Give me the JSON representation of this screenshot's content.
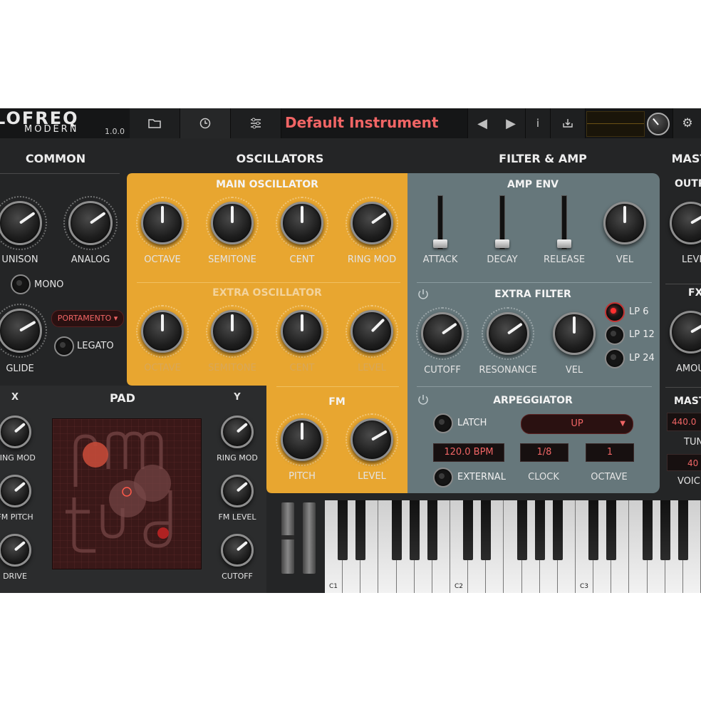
{
  "toolbar": {
    "logo_line1": "LOFREQ",
    "logo_line2": "MODERN",
    "version": "1.0.0",
    "preset_name": "Default Instrument",
    "info_label": "i"
  },
  "sections": {
    "common": "COMMON",
    "oscillators": "OSCILLATORS",
    "filter_amp": "FILTER & AMP",
    "master": "MAST"
  },
  "common": {
    "unison": "UNISON",
    "analog": "ANALOG",
    "mono": "MONO",
    "portamento": "PORTAMENTO ▾",
    "legato": "LEGATO",
    "glide": "GLIDE"
  },
  "main_osc": {
    "title": "MAIN OSCILLATOR",
    "knobs": [
      "OCTAVE",
      "SEMITONE",
      "CENT",
      "RING MOD"
    ]
  },
  "extra_osc": {
    "title": "EXTRA OSCILLATOR",
    "knobs": [
      "OCTAVE",
      "SEMITONE",
      "CENT",
      "LEVEL"
    ]
  },
  "fm": {
    "title": "FM",
    "pitch": "PITCH",
    "level": "LEVEL"
  },
  "amp_env": {
    "title": "AMP ENV",
    "attack": "ATTACK",
    "decay": "DECAY",
    "release": "RELEASE",
    "vel": "VEL"
  },
  "extra_filter": {
    "title": "EXTRA FILTER",
    "cutoff": "CUTOFF",
    "resonance": "RESONANCE",
    "vel": "VEL",
    "modes": [
      "LP 6",
      "LP 12",
      "LP 24"
    ],
    "selected_mode": "LP 6"
  },
  "arp": {
    "title": "ARPEGGIATOR",
    "latch": "LATCH",
    "direction": "UP",
    "bpm": "120.0 BPM",
    "clock_value": "1/8",
    "octave_value": "1",
    "external": "EXTERNAL",
    "clock": "CLOCK",
    "octave": "OCTAVE"
  },
  "master_partial": {
    "output": "OUTP",
    "level": "LEVE",
    "fx": "FX",
    "amount": "AMOU",
    "master": "MAST",
    "tune_value": "440.0",
    "tune": "TUN",
    "voices_value": "40",
    "voices": "VOICE"
  },
  "pad": {
    "title": "PAD",
    "x": "X",
    "y": "Y",
    "left_knobs": [
      "RING MOD",
      "FM PITCH",
      "DRIVE"
    ],
    "right_knobs": [
      "RING MOD",
      "FM LEVEL",
      "CUTOFF"
    ]
  },
  "keyboard": {
    "octave_labels": [
      "C1",
      "C2",
      "C3"
    ]
  },
  "colors": {
    "background": "#242526",
    "oscillator_panel": "#e8a630",
    "filter_panel": "#66777b",
    "accent_red": "#f06565"
  }
}
